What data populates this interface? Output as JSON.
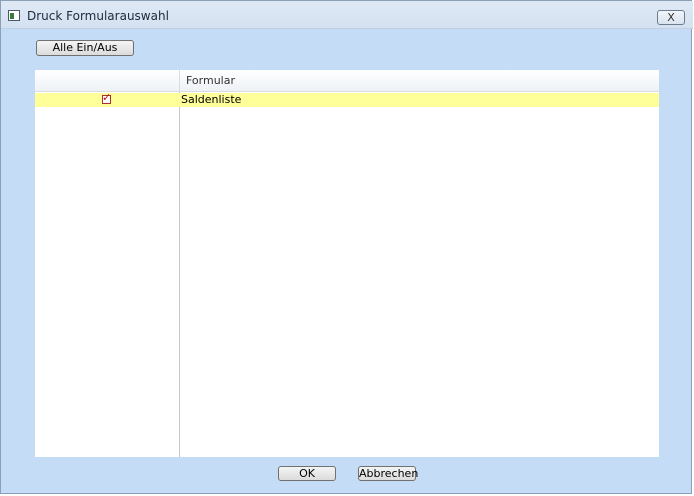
{
  "window": {
    "title": "Druck Formularauswahl",
    "close_label": "X"
  },
  "toolbar": {
    "toggle_all_label": "Alle Ein/Aus"
  },
  "grid": {
    "columns": [
      "",
      "Formular"
    ],
    "rows": [
      {
        "checked": true,
        "formular": "Saldenliste",
        "highlight_color": "#ffff99"
      }
    ]
  },
  "footer": {
    "ok_label": "OK",
    "cancel_label": "Abbrechen"
  },
  "colors": {
    "window_background": "#c4dcf6",
    "checkmark": "#c01818"
  }
}
